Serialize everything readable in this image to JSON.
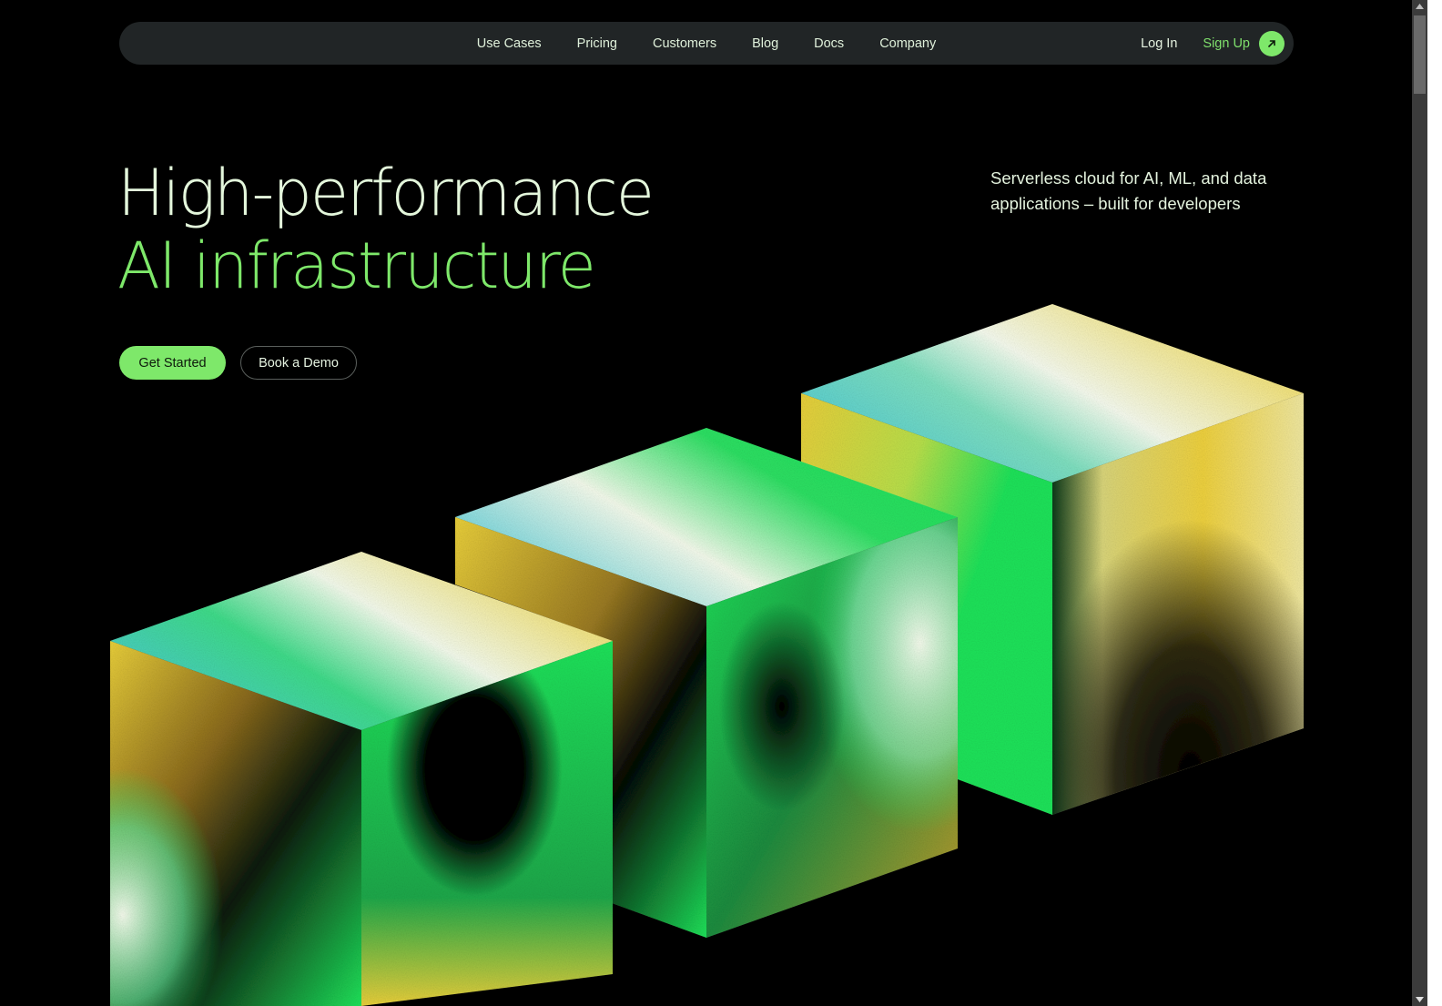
{
  "nav": {
    "links": [
      {
        "label": "Use Cases"
      },
      {
        "label": "Pricing"
      },
      {
        "label": "Customers"
      },
      {
        "label": "Blog"
      },
      {
        "label": "Docs"
      },
      {
        "label": "Company"
      }
    ],
    "login_label": "Log In",
    "signup_label": "Sign Up",
    "signup_icon": "arrow-up-right-icon"
  },
  "hero": {
    "title_line1": "High-performance",
    "title_line2": "AI infrastructure",
    "subtitle": "Serverless cloud for AI, ML, and data applications – built for developers",
    "primary_cta": "Get Started",
    "secondary_cta": "Book a Demo"
  },
  "art": {
    "description": "Three isometric cubes with grainy green, yellow, cyan and white gradients",
    "cube_count": 3
  },
  "colors": {
    "background": "#000000",
    "nav_bg": "#212526",
    "accent_green": "#7ee86a",
    "title_light": "#e4f7dc",
    "cube_green": "#1ee35a",
    "cube_yellow": "#e9cf3a",
    "cube_cyan": "#4cc9d6",
    "cube_white": "#f3faea"
  }
}
